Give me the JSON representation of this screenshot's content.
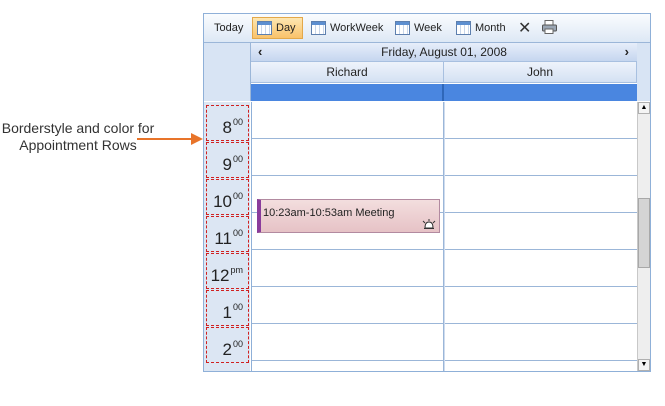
{
  "annotation": {
    "text": "Borderstyle and color for Appointment Rows"
  },
  "toolbar": {
    "today_label": "Today",
    "day_label": "Day",
    "workweek_label": "WorkWeek",
    "week_label": "Week",
    "month_label": "Month",
    "active_view": "Day"
  },
  "nav": {
    "prev": "‹",
    "date": "Friday, August 01, 2008",
    "next": "›"
  },
  "resources": [
    "Richard",
    "John"
  ],
  "time_slots": [
    {
      "hour": "8",
      "suffix": "00"
    },
    {
      "hour": "9",
      "suffix": "00"
    },
    {
      "hour": "10",
      "suffix": "00"
    },
    {
      "hour": "11",
      "suffix": "00"
    },
    {
      "hour": "12",
      "suffix": "pm"
    },
    {
      "hour": "1",
      "suffix": "00"
    },
    {
      "hour": "2",
      "suffix": "00"
    }
  ],
  "appointment": {
    "text": "10:23am-10:53am Meeting",
    "resource": "Richard"
  },
  "scroll": {
    "up": "▲",
    "down": "▼"
  },
  "colors": {
    "slot_border": "#d02020",
    "allday": "#4a86e0",
    "appointment_bg": "#e6c2c6",
    "appointment_marker": "#8a3c9c",
    "arrow": "#e8742a"
  }
}
